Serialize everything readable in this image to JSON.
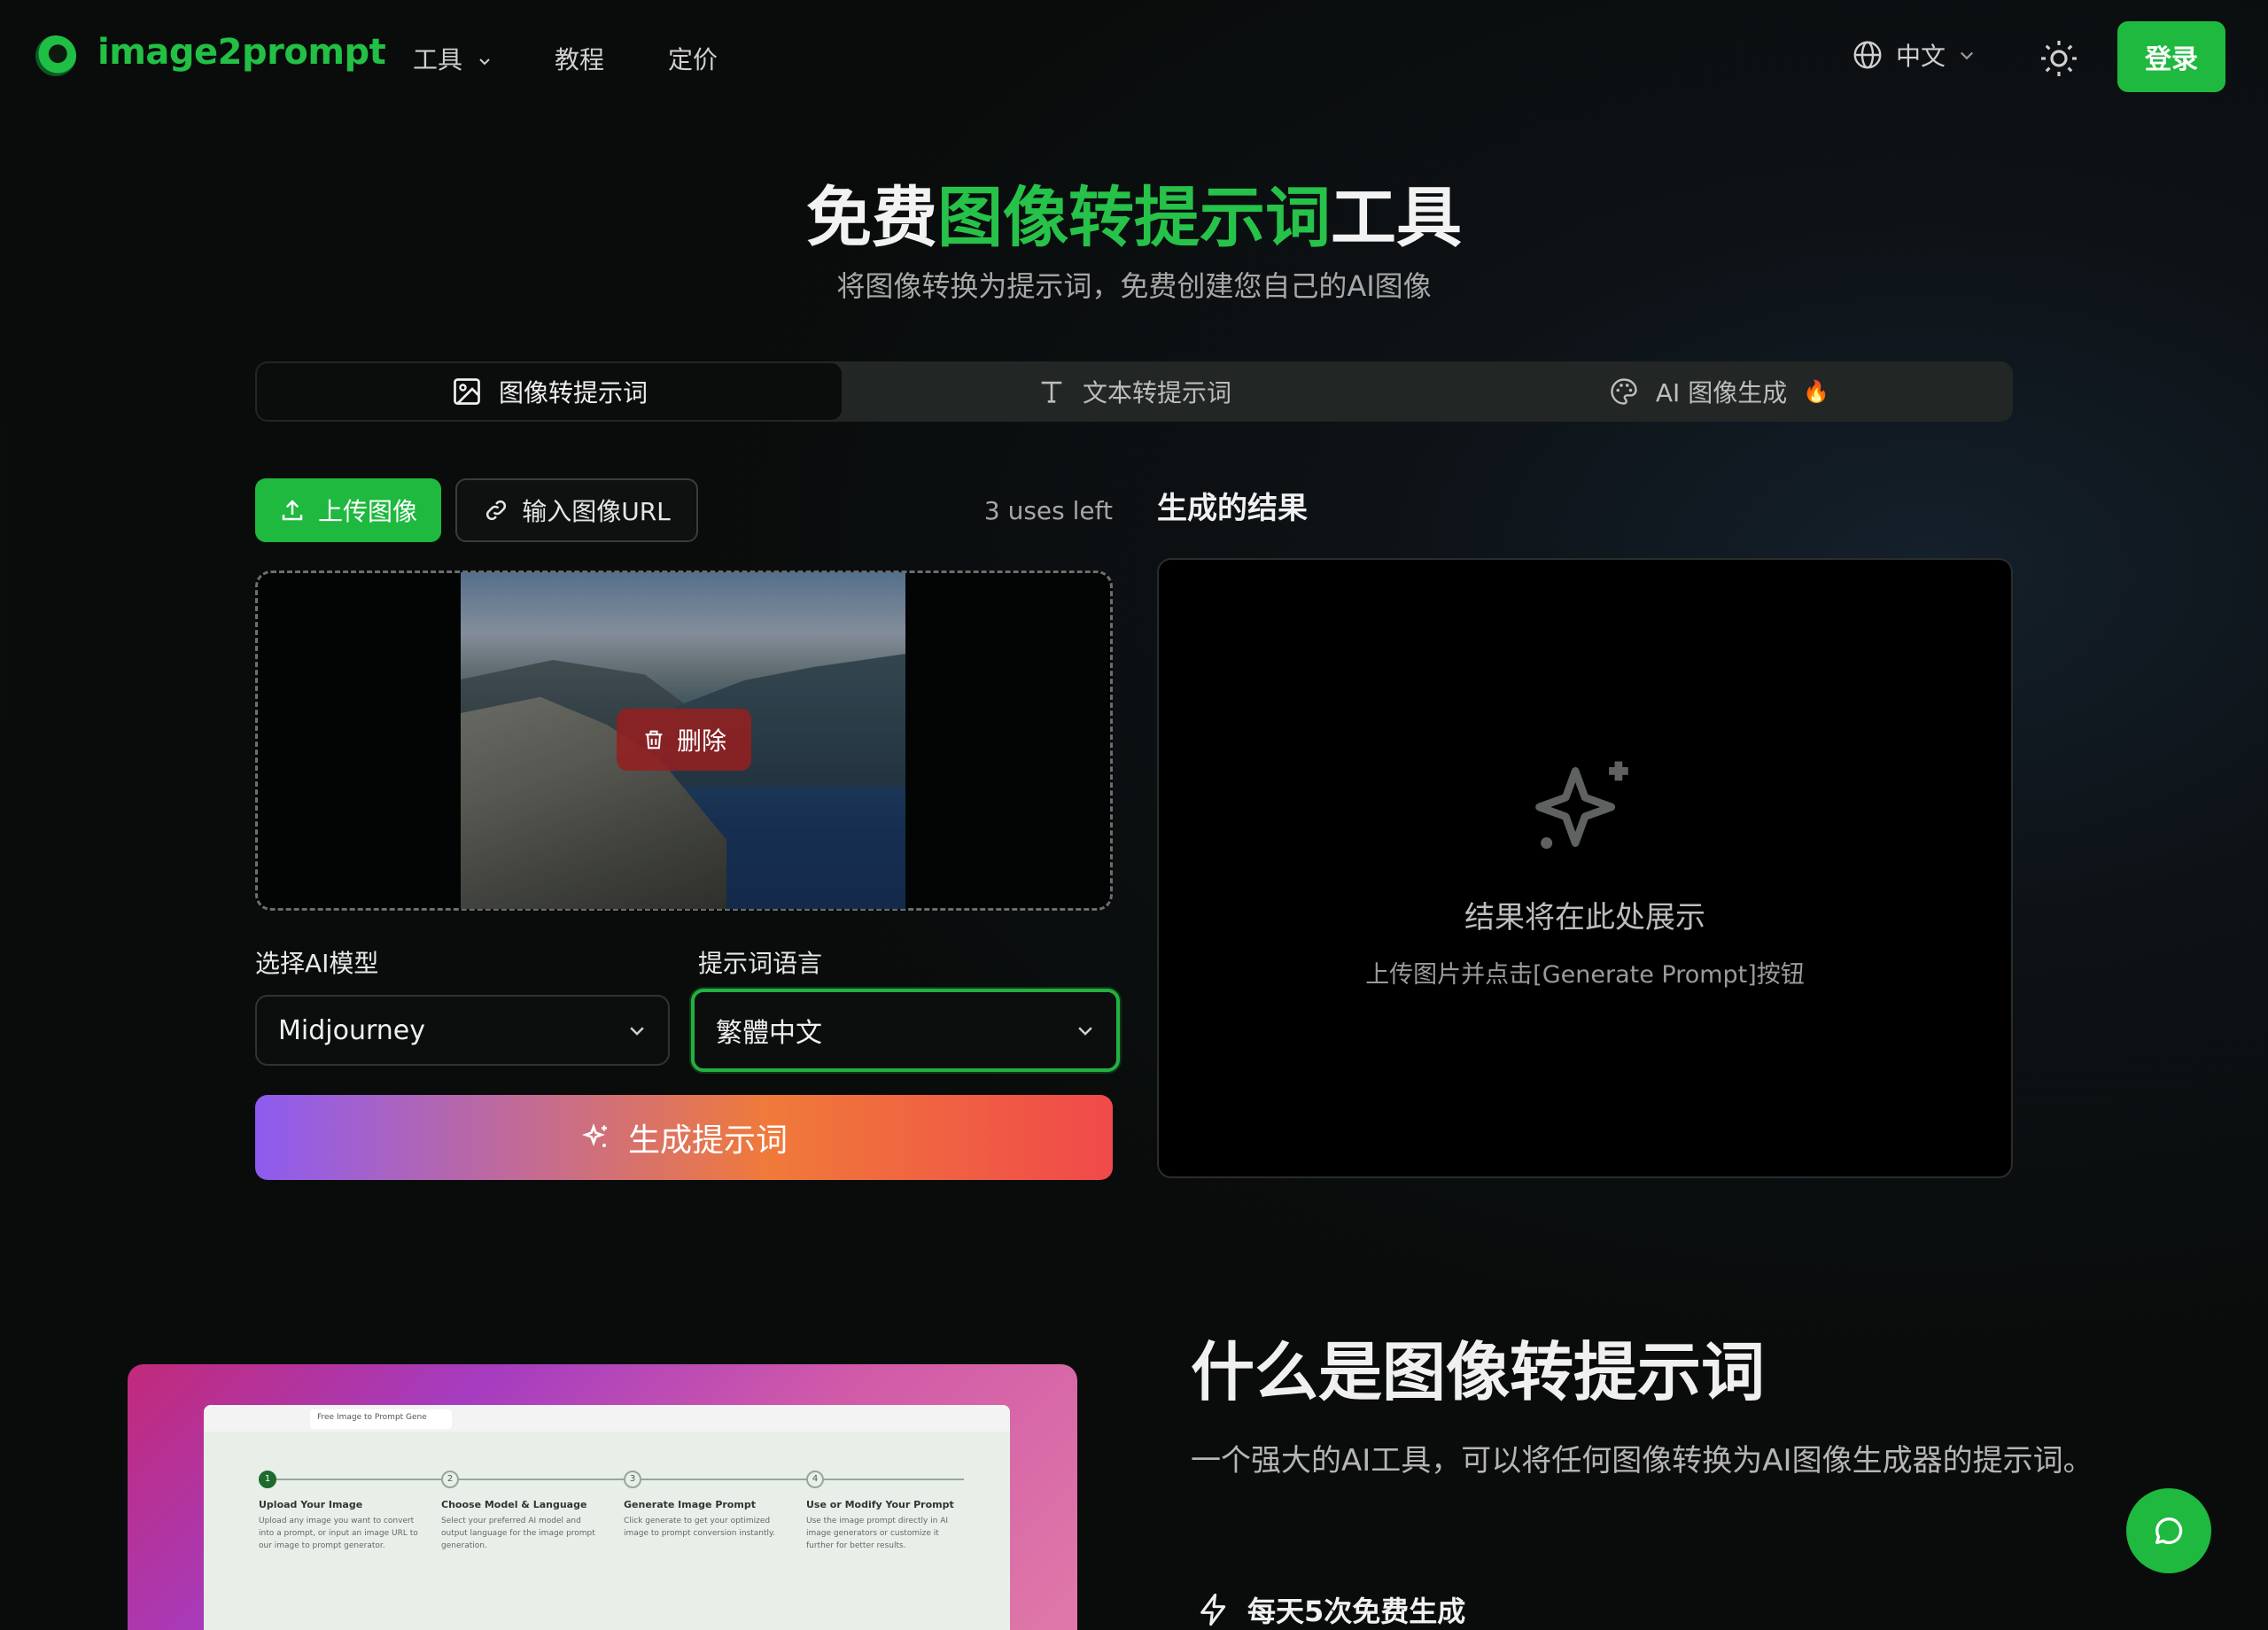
{
  "header": {
    "logo_text": "image2prompt",
    "nav": [
      {
        "label": "工具"
      },
      {
        "label": "教程"
      },
      {
        "label": "定价"
      }
    ],
    "language": "中文",
    "login_label": "登录"
  },
  "hero": {
    "title_pre": "免费",
    "title_accent": "图像转提示词",
    "title_post": "工具",
    "subtitle": "将图像转换为提示词，免费创建您自己的AI图像"
  },
  "tabs": [
    {
      "label": "图像转提示词",
      "icon": "image-icon",
      "active": true
    },
    {
      "label": "文本转提示词",
      "icon": "text-icon",
      "active": false
    },
    {
      "label": "AI 图像生成",
      "icon": "palette-icon",
      "badge": "🔥",
      "active": false
    }
  ],
  "upload": {
    "upload_label": "上传图像",
    "url_label": "输入图像URL",
    "uses_left": "3 uses left",
    "delete_label": "删除"
  },
  "form": {
    "model_label": "选择AI模型",
    "model_value": "Midjourney",
    "lang_label": "提示词语言",
    "lang_value": "繁體中文",
    "generate_label": "生成提示词"
  },
  "result": {
    "title": "生成的结果",
    "empty_title": "结果将在此处展示",
    "empty_sub": "上传图片并点击[Generate Prompt]按钮"
  },
  "promo": {
    "tab_label": "Free Image to Prompt Gene",
    "steps": [
      {
        "n": "1",
        "title": "Upload Your Image",
        "desc": "Upload any image you want to convert into a prompt, or input an image URL to our image to prompt generator."
      },
      {
        "n": "2",
        "title": "Choose Model & Language",
        "desc": "Select your preferred AI model and output language for the image prompt generation."
      },
      {
        "n": "3",
        "title": "Generate Image Prompt",
        "desc": "Click generate to get your optimized image to prompt conversion instantly."
      },
      {
        "n": "4",
        "title": "Use or Modify Your Prompt",
        "desc": "Use the image prompt directly in AI image generators or customize it further for better results."
      }
    ]
  },
  "what": {
    "title": "什么是图像转提示词",
    "desc": "一个强大的AI工具，可以将任何图像转换为AI图像生成器的提示词。",
    "feature_1": "每天5次免费生成"
  },
  "colors": {
    "brand_green": "#1eb93e",
    "accent_green": "#26c24a"
  }
}
